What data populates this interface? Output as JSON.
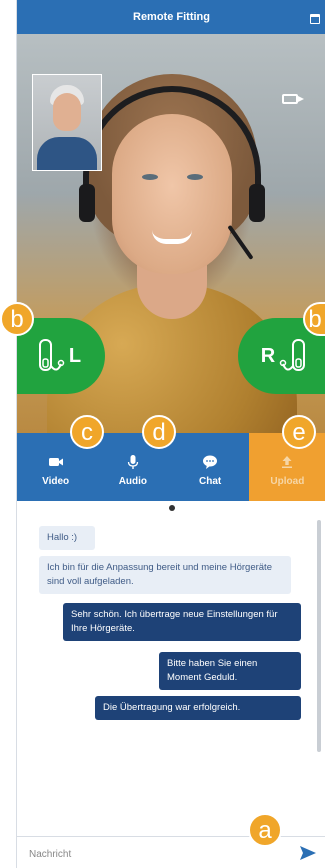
{
  "app": {
    "title": "Remote Fitting"
  },
  "hearing_aids": {
    "left_label": "L",
    "right_label": "R"
  },
  "controls": [
    {
      "label": "Video",
      "icon": "video-camera-icon",
      "active": false
    },
    {
      "label": "Audio",
      "icon": "microphone-icon",
      "active": false
    },
    {
      "label": "Chat",
      "icon": "chat-bubble-icon",
      "active": false
    },
    {
      "label": "Upload",
      "icon": "upload-icon",
      "active": true
    }
  ],
  "messages": [
    {
      "from": "client",
      "text": "Hallo :)"
    },
    {
      "from": "client",
      "text": "Ich bin für die Anpassung bereit und meine Hörgeräte sind voll aufgeladen."
    },
    {
      "from": "audiologist",
      "text": "Sehr schön. Ich übertrage neue Einstellungen für Ihre Hörgeräte."
    },
    {
      "from": "audiologist",
      "text": "Bitte haben Sie einen Moment Geduld."
    },
    {
      "from": "audiologist",
      "text": "Die Übertragung war erfolgreich."
    }
  ],
  "input": {
    "placeholder": "Nachricht"
  },
  "callouts": {
    "a": "a",
    "b": "b",
    "c": "c",
    "d": "d",
    "e": "e"
  },
  "colors": {
    "brand_blue": "#2b6fb4",
    "hearing_aid_green": "#21a33f",
    "active_orange": "#f0a030",
    "callout_orange": "#f0a62a",
    "bubble_dark": "#1e4277",
    "bubble_light": "#e8eef6"
  }
}
